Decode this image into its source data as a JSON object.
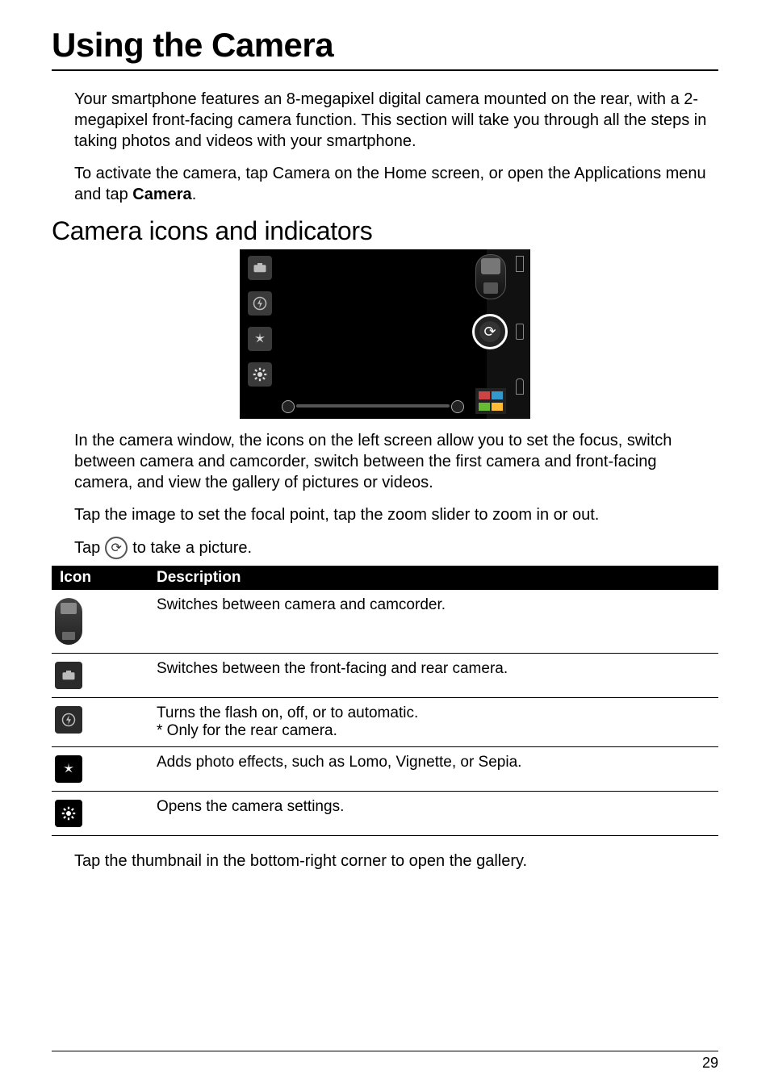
{
  "title": "Using the Camera",
  "intro_para": "Your smartphone features an 8-megapixel digital camera mounted on the rear, with a 2-megapixel front-facing camera function. This section will take you through all the steps in taking photos and videos with your smartphone.",
  "activate_para_before": "To activate the camera, tap Camera on the Home screen, or open the Applications menu and tap ",
  "activate_para_bold": "Camera",
  "activate_para_after": ".",
  "subheading": "Camera icons and indicators",
  "after_screenshot_para": "In the camera window, the icons on the left screen allow you to set the focus, switch between camera and camcorder, switch between the first camera and front-facing camera, and view the gallery of pictures or videos.",
  "zoom_para": "Tap the image to set the focal point, tap the zoom slider to zoom in or out.",
  "take_picture_before": "Tap ",
  "take_picture_after": " to take a picture.",
  "table": {
    "headers": {
      "icon": "Icon",
      "description": "Description"
    },
    "rows": [
      {
        "desc": "Switches between camera and camcorder."
      },
      {
        "desc": "Switches between the front-facing and rear camera."
      },
      {
        "desc": "Turns the flash on, off, or to automatic.",
        "desc2": "* Only for the rear camera."
      },
      {
        "desc": "Adds photo effects, such as Lomo, Vignette, or Sepia."
      },
      {
        "desc": "Opens the camera settings."
      }
    ]
  },
  "gallery_para": "Tap the thumbnail in the bottom-right corner to open the gallery.",
  "page_number": "29",
  "icons": {
    "camera_switch": "camera-switch-icon",
    "front_rear": "front-rear-camera-icon",
    "flash": "flash-icon",
    "effects": "effects-icon",
    "settings": "settings-icon",
    "shutter": "shutter-icon",
    "gallery": "gallery-thumbnail-icon"
  }
}
